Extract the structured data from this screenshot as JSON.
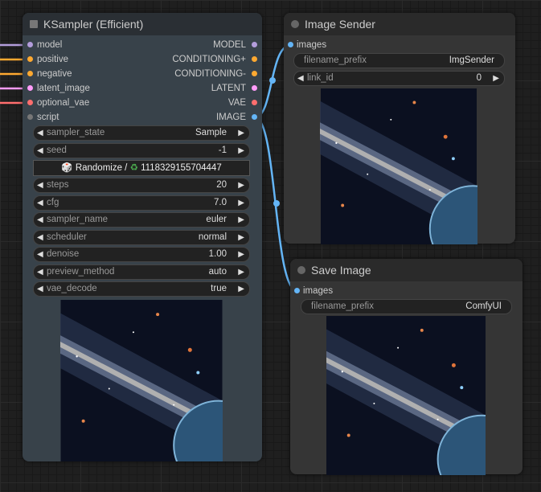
{
  "ksampler": {
    "title": "KSampler (Efficient)",
    "inputs": [
      {
        "label": "model",
        "color": "#b39ddb"
      },
      {
        "label": "positive",
        "color": "#ffa931"
      },
      {
        "label": "negative",
        "color": "#ffa931"
      },
      {
        "label": "latent_image",
        "color": "#ff9cf9"
      },
      {
        "label": "optional_vae",
        "color": "#ff6e6e"
      },
      {
        "label": "script",
        "color": "#777777"
      }
    ],
    "outputs": [
      {
        "label": "MODEL",
        "color": "#b39ddb"
      },
      {
        "label": "CONDITIONING+",
        "color": "#ffa931"
      },
      {
        "label": "CONDITIONING-",
        "color": "#ffa931"
      },
      {
        "label": "LATENT",
        "color": "#ff9cf9"
      },
      {
        "label": "VAE",
        "color": "#ff6e6e"
      },
      {
        "label": "IMAGE",
        "color": "#64b5f6"
      }
    ],
    "widgets": {
      "sampler_state": {
        "label": "sampler_state",
        "value": "Sample"
      },
      "seed": {
        "label": "seed",
        "value": "-1"
      },
      "randomize": "Randomize / ",
      "seed_value": "1118329155704447",
      "steps": {
        "label": "steps",
        "value": "20"
      },
      "cfg": {
        "label": "cfg",
        "value": "7.0"
      },
      "sampler_name": {
        "label": "sampler_name",
        "value": "euler"
      },
      "scheduler": {
        "label": "scheduler",
        "value": "normal"
      },
      "denoise": {
        "label": "denoise",
        "value": "1.00"
      },
      "preview_method": {
        "label": "preview_method",
        "value": "auto"
      },
      "vae_decode": {
        "label": "vae_decode",
        "value": "true"
      }
    }
  },
  "image_sender": {
    "title": "Image Sender",
    "input": "images",
    "filename_prefix": {
      "label": "filename_prefix",
      "value": "ImgSender"
    },
    "link_id": {
      "label": "link_id",
      "value": "0"
    }
  },
  "save_image": {
    "title": "Save Image",
    "input": "images",
    "filename_prefix": {
      "label": "filename_prefix",
      "value": "ComfyUI"
    }
  },
  "colors": {
    "image_link": "#64b5f6",
    "ksampler_bg": "#38424a",
    "node_bg": "#353535",
    "title_bg": "#2a2a2a"
  }
}
